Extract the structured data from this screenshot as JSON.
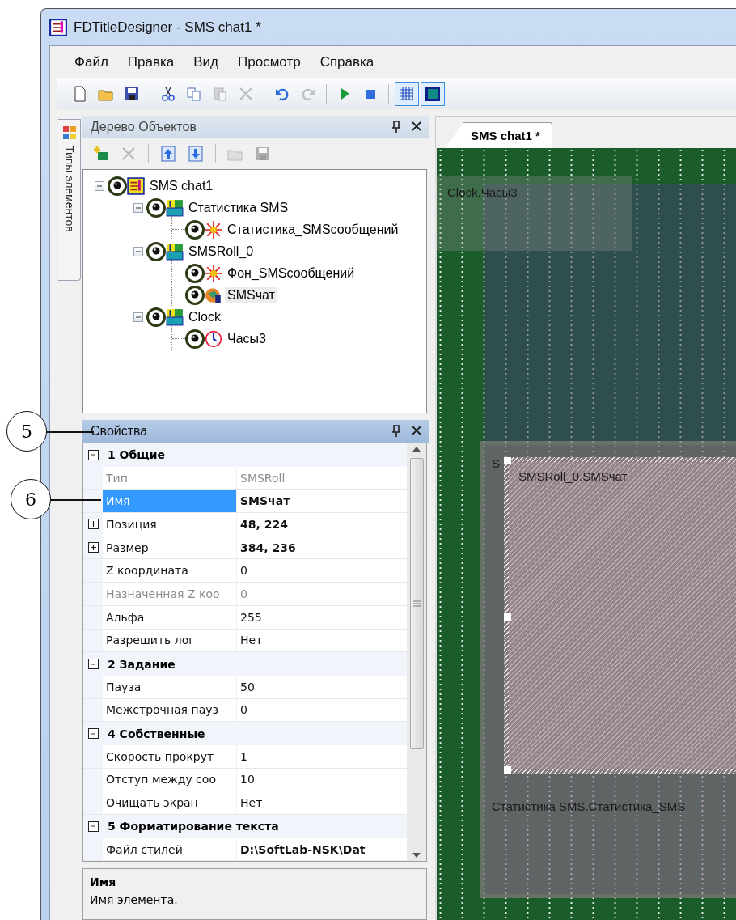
{
  "window": {
    "title": "FDTitleDesigner - SMS chat1 *"
  },
  "menu": [
    "Файл",
    "Правка",
    "Вид",
    "Просмотр",
    "Справка"
  ],
  "toolbar": {
    "groups": [
      [
        {
          "kind": "new",
          "disabled": false
        },
        {
          "kind": "open",
          "disabled": false
        },
        {
          "kind": "save",
          "disabled": false
        }
      ],
      [
        {
          "kind": "cut",
          "disabled": false
        },
        {
          "kind": "copy",
          "disabled": false
        },
        {
          "kind": "paste",
          "disabled": true
        },
        {
          "kind": "delete",
          "disabled": true
        }
      ],
      [
        {
          "kind": "undo",
          "disabled": false
        },
        {
          "kind": "redo",
          "disabled": true
        }
      ],
      [
        {
          "kind": "play",
          "disabled": false
        },
        {
          "kind": "stop",
          "disabled": false
        }
      ],
      [
        {
          "kind": "grid",
          "disabled": false,
          "on": true
        },
        {
          "kind": "fill",
          "disabled": false,
          "on": true
        }
      ]
    ]
  },
  "side_tab": {
    "label": "Типы элементов"
  },
  "object_tree": {
    "title": "Дерево Объектов",
    "toolbar": [
      {
        "kind": "add",
        "disabled": false
      },
      {
        "kind": "delete",
        "disabled": true
      },
      {
        "kind": "up",
        "disabled": false
      },
      {
        "kind": "down",
        "disabled": false
      },
      {
        "kind": "load",
        "disabled": true
      },
      {
        "kind": "store",
        "disabled": true
      }
    ],
    "items": [
      {
        "label": "SMS chat1",
        "kind": "scene",
        "expanded": true,
        "selected": false,
        "children": [
          {
            "label": "Статистика SMS",
            "kind": "layer",
            "expanded": true,
            "selected": false,
            "children": [
              {
                "label": "Статистика_SMSсообщений",
                "kind": "effect",
                "selected": false
              }
            ]
          },
          {
            "label": "SMSRoll_0",
            "kind": "layer",
            "expanded": true,
            "selected": false,
            "children": [
              {
                "label": "Фон_SMSсообщений",
                "kind": "effect",
                "selected": false
              },
              {
                "label": "SMSчат",
                "kind": "chat",
                "selected": true
              }
            ]
          },
          {
            "label": "Clock",
            "kind": "layer",
            "expanded": true,
            "selected": false,
            "children": [
              {
                "label": "Часы3",
                "kind": "clock",
                "selected": false
              }
            ]
          }
        ]
      }
    ]
  },
  "properties": {
    "title": "Свойства",
    "categories": [
      {
        "label": "1 Общие",
        "expanded": true,
        "rows": [
          {
            "name": "Тип",
            "value": "SMSRoll",
            "readonly": true,
            "modified": false,
            "expandable": false,
            "selected": false
          },
          {
            "name": "Имя",
            "value": "SMSчат",
            "readonly": false,
            "modified": true,
            "expandable": false,
            "selected": true
          },
          {
            "name": "Позиция",
            "value": "48, 224",
            "readonly": false,
            "modified": true,
            "expandable": true,
            "selected": false
          },
          {
            "name": "Размер",
            "value": "384, 236",
            "readonly": false,
            "modified": true,
            "expandable": true,
            "selected": false
          },
          {
            "name": "Z координата",
            "value": "0",
            "readonly": false,
            "modified": false,
            "expandable": false,
            "selected": false
          },
          {
            "name": "Назначенная Z коо",
            "value": "0",
            "readonly": true,
            "modified": false,
            "expandable": false,
            "selected": false
          },
          {
            "name": "Альфа",
            "value": "255",
            "readonly": false,
            "modified": false,
            "expandable": false,
            "selected": false
          },
          {
            "name": "Разрешить лог",
            "value": "Нет",
            "readonly": false,
            "modified": false,
            "expandable": false,
            "selected": false
          }
        ]
      },
      {
        "label": "2 Задание",
        "expanded": true,
        "rows": [
          {
            "name": "Пауза",
            "value": "50",
            "readonly": false,
            "modified": false,
            "expandable": false,
            "selected": false
          },
          {
            "name": "Межстрочная пауз",
            "value": "0",
            "readonly": false,
            "modified": false,
            "expandable": false,
            "selected": false
          }
        ]
      },
      {
        "label": "4 Собственные",
        "expanded": true,
        "rows": [
          {
            "name": "Скорость прокрут",
            "value": "1",
            "readonly": false,
            "modified": false,
            "expandable": false,
            "selected": false
          },
          {
            "name": "Отступ между соо",
            "value": "10",
            "readonly": false,
            "modified": false,
            "expandable": false,
            "selected": false
          },
          {
            "name": "Очищать экран",
            "value": "Нет",
            "readonly": false,
            "modified": false,
            "expandable": false,
            "selected": false
          }
        ]
      },
      {
        "label": "5 Форматирование текста",
        "expanded": true,
        "rows": [
          {
            "name": "Файл стилей",
            "value": "D:\\SoftLab-NSK\\Dat",
            "readonly": false,
            "modified": true,
            "expandable": false,
            "selected": false
          }
        ]
      }
    ]
  },
  "description": {
    "title": "Имя",
    "text": "Имя элемента."
  },
  "editor": {
    "tab": {
      "label": "SMS chat1 *",
      "selected": true
    },
    "objects": [
      {
        "kind": "background",
        "selected": false
      },
      {
        "kind": "clock",
        "label": "Clock.Часы3",
        "selected": false
      },
      {
        "kind": "stats",
        "label": "Статистика SMS.Статистика_SMS",
        "selected": false,
        "children": [
          {
            "kind": "roll_background",
            "label": "S",
            "selected": false
          },
          {
            "kind": "chat",
            "label": "SMSRoll_0.SMSчат",
            "selected": true
          }
        ]
      }
    ]
  },
  "callouts": [
    {
      "label": "5"
    },
    {
      "label": "6"
    }
  ]
}
